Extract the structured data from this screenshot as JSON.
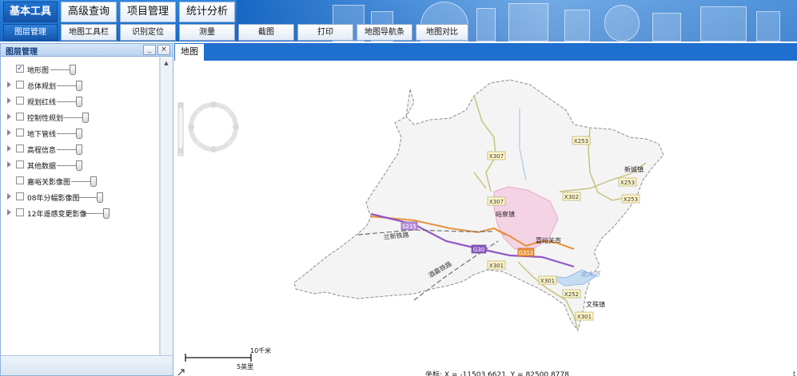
{
  "header": {
    "top_tabs": [
      "基本工具",
      "高级查询",
      "项目管理",
      "统计分析"
    ],
    "sub_tabs": [
      "图层管理",
      "地图工具栏",
      "识别定位",
      "测量",
      "截图",
      "打印",
      "地图导航条",
      "地图对比"
    ]
  },
  "panel": {
    "title": "图层管理",
    "minimize_label": "_",
    "close_label": "×",
    "layers": [
      {
        "name": "地形图",
        "checked": true,
        "expandable": false
      },
      {
        "name": "总体规划",
        "checked": false,
        "expandable": true
      },
      {
        "name": "规划红线",
        "checked": false,
        "expandable": true
      },
      {
        "name": "控制性规划",
        "checked": false,
        "expandable": true
      },
      {
        "name": "地下管线",
        "checked": false,
        "expandable": true
      },
      {
        "name": "高程信息",
        "checked": false,
        "expandable": true
      },
      {
        "name": "其他数据",
        "checked": false,
        "expandable": true
      },
      {
        "name": "嘉峪关影像图",
        "checked": false,
        "expandable": false
      },
      {
        "name": "08年分幅影像图",
        "checked": false,
        "expandable": true
      },
      {
        "name": "12年遥感变更影像",
        "checked": false,
        "expandable": true
      }
    ]
  },
  "map": {
    "tab_label": "地图",
    "scale_km": "10千米",
    "scale_mi": "5英里",
    "coords_text": "坐标: X = -11503.6621, Y = 82500.8778",
    "corner_char": "t",
    "labels": {
      "yuquan": "峪泉镇",
      "jiayuguan": "嘉峪关市",
      "xincheng": "新城镇",
      "wenshu": "文殊镇",
      "lanxin": "兰新铁路",
      "jiuquan_rail": "酒嘉铁路",
      "beidahe": "北大河"
    },
    "road_badges": [
      "X307",
      "X307",
      "X253",
      "X253",
      "X253",
      "X302",
      "S215",
      "G30",
      "G312",
      "X301",
      "X301",
      "X252",
      "X301"
    ]
  }
}
